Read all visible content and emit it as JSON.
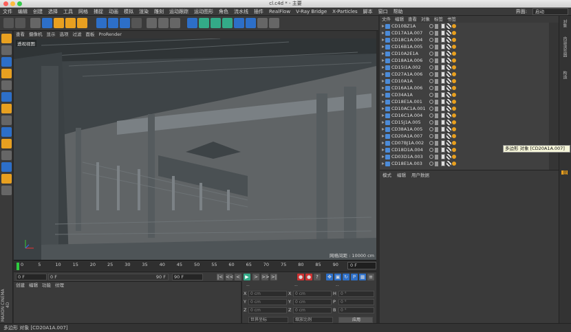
{
  "window": {
    "title": "cl.c4d * - 主要"
  },
  "menubar": {
    "items": [
      "文件",
      "编辑",
      "创建",
      "选择",
      "工具",
      "网格",
      "捕捉",
      "动画",
      "模拟",
      "渲染",
      "雕刻",
      "运动跟踪",
      "运动图形",
      "角色",
      "流水线",
      "插件",
      "RealFlow",
      "V-Ray Bridge",
      "X-Particles",
      "脚本",
      "窗口",
      "帮助"
    ],
    "layout_label": "界面:",
    "layout_value": "启动"
  },
  "viewport": {
    "menu": [
      "查看",
      "摄像机",
      "显示",
      "选项",
      "过滤",
      "面板",
      "ProRender"
    ],
    "view_name": "透视视图",
    "grid_spacing": "网格间距 : 10000 cm",
    "axis": {
      "x": "X",
      "y": "Y",
      "z": "Z"
    }
  },
  "timeline": {
    "ticks": [
      "0",
      "5",
      "10",
      "15",
      "20",
      "25",
      "30",
      "35",
      "40",
      "45",
      "50",
      "55",
      "60",
      "65",
      "70",
      "75",
      "80",
      "85",
      "90"
    ],
    "current_frame": "0 F"
  },
  "transport": {
    "start": "0 F",
    "start2": "0 F",
    "end": "90 F",
    "end2": "90 F",
    "buttons": [
      "|<",
      "<<",
      "<",
      "▶",
      ">",
      ">>",
      ">|"
    ]
  },
  "material_manager": {
    "tabs": [
      "创建",
      "编辑",
      "功能",
      "纹理"
    ]
  },
  "coordinates": {
    "headers": [
      "--",
      "--",
      "--"
    ],
    "rows": [
      {
        "a": "X",
        "av": "0 cm",
        "b": "X",
        "bv": "0 cm",
        "c": "H",
        "cv": "0 °"
      },
      {
        "a": "Y",
        "av": "0 cm",
        "b": "Y",
        "bv": "0 cm",
        "c": "P",
        "cv": "0 °"
      },
      {
        "a": "Z",
        "av": "0 cm",
        "b": "Z",
        "bv": "0 cm",
        "c": "B",
        "cv": "0 °"
      }
    ],
    "mode1": "世界坐标",
    "mode2": "缩放比例",
    "apply": "应用"
  },
  "object_manager": {
    "tabs": [
      "文件",
      "编辑",
      "查看",
      "对象",
      "标签",
      "书签"
    ],
    "objects": [
      "CD10BZ1A",
      "CD17A1A.007",
      "CD18C1A.004",
      "CD16B1A.005",
      "CD10A2E1A",
      "CD18A1A.006",
      "CD15I1A.002",
      "CD27A1A.006",
      "CD10A1A",
      "CD16A1A.006",
      "CD34A1A",
      "CD18E1A.001",
      "CD10AC1A.001",
      "CD16C1A.004",
      "CD15J1A.005",
      "CD38A1A.005",
      "CD20A1A.007",
      "CD07BJ1A.002",
      "CD18D1A.004",
      "CD03D1A.003",
      "CD18E1A.003"
    ]
  },
  "attribute_manager": {
    "tabs": [
      "模式",
      "编辑",
      "用户数据"
    ]
  },
  "right_strip": {
    "tabs": [
      "对象",
      "内容浏览器",
      "构造",
      "层"
    ]
  },
  "tooltip": "多边形 对象 [CD20A1A.007]",
  "statusbar": {
    "text": "多边形 对象 [CD20A1A.007]"
  },
  "brand": "MAXON CINEMA 4D",
  "colors": {
    "accent_blue": "#4c8bd8",
    "tag_orange": "#e8a020",
    "timeline_green": "#2ecc40"
  }
}
